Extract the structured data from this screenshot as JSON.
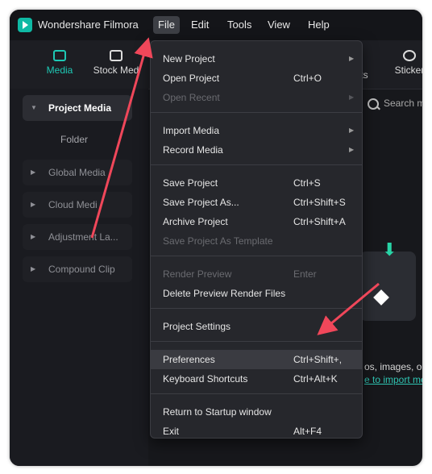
{
  "app": {
    "title": "Wondershare Filmora"
  },
  "menubar": {
    "items": [
      "File",
      "Edit",
      "Tools",
      "View",
      "Help"
    ],
    "active": "File"
  },
  "toolbar": {
    "media": "Media",
    "stock": "Stock Med",
    "stickers": "Sticker",
    "effects_partial": "ts"
  },
  "sidebar": {
    "project_media": "Project Media",
    "folder": "Folder",
    "global_media": "Global Media",
    "cloud_media": "Cloud Medi",
    "adjustment": "Adjustment La...",
    "compound": "Compound Clip"
  },
  "search": {
    "placeholder": "Search m"
  },
  "empty_state": {
    "text": "os, images, or a",
    "link": "e to import me"
  },
  "file_menu": {
    "new_project": "New Project",
    "open_project": "Open Project",
    "open_project_sc": "Ctrl+O",
    "open_recent": "Open Recent",
    "import_media": "Import Media",
    "record_media": "Record Media",
    "save_project": "Save Project",
    "save_project_sc": "Ctrl+S",
    "save_project_as": "Save Project As...",
    "save_project_as_sc": "Ctrl+Shift+S",
    "archive_project": "Archive Project",
    "archive_project_sc": "Ctrl+Shift+A",
    "save_as_template": "Save Project As Template",
    "render_preview": "Render Preview",
    "render_preview_sc": "Enter",
    "delete_preview": "Delete Preview Render Files",
    "project_settings": "Project Settings",
    "preferences": "Preferences",
    "preferences_sc": "Ctrl+Shift+,",
    "keyboard_shortcuts": "Keyboard Shortcuts",
    "keyboard_shortcuts_sc": "Ctrl+Alt+K",
    "return_startup": "Return to Startup window",
    "exit": "Exit",
    "exit_sc": "Alt+F4"
  },
  "colors": {
    "accent": "#1ec8b4",
    "annotation_arrow": "#f0475a"
  }
}
